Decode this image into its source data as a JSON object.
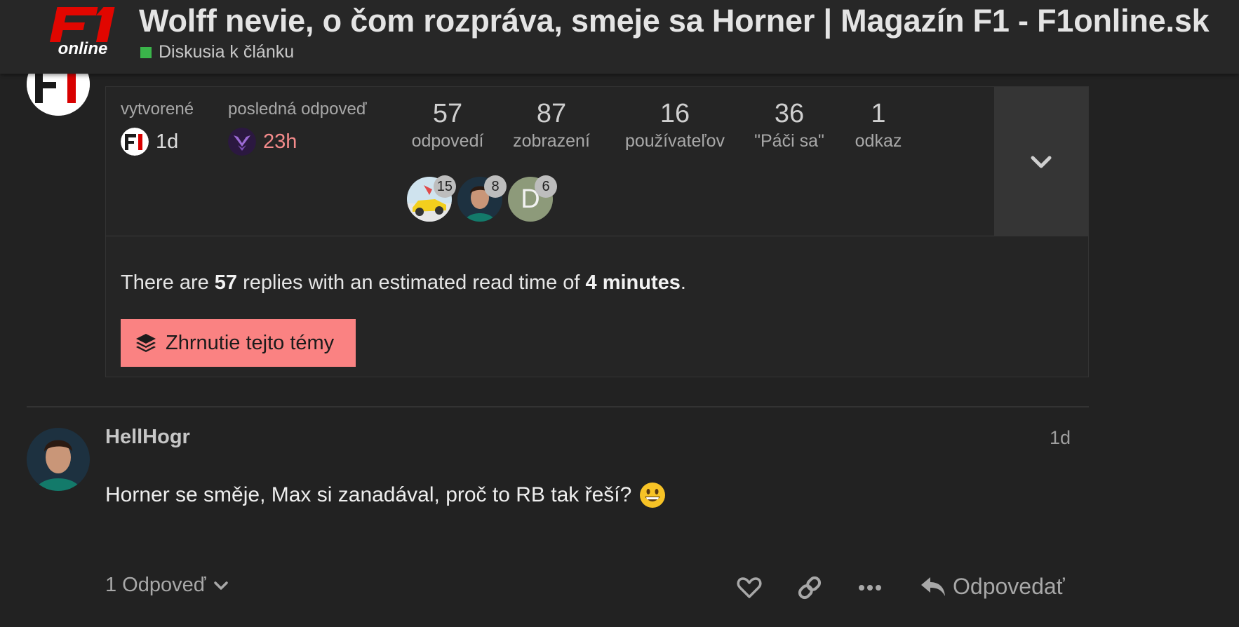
{
  "header": {
    "logo_text": "F1 online",
    "title": "Wolff nevie, o čom rozpráva, smeje sa Horner | Magazín F1 - F1online.sk",
    "category": "Diskusia k článku",
    "category_color": "#3ab54a"
  },
  "topic_map": {
    "created_label": "vytvorené",
    "created_time": "1d",
    "last_reply_label": "posledná odpoveď",
    "last_reply_time": "23h",
    "stats": [
      {
        "num": "57",
        "label": "odpovedí"
      },
      {
        "num": "87",
        "label": "zobrazení"
      },
      {
        "num": "16",
        "label": "používateľov"
      },
      {
        "num": "36",
        "label": "\"Páči sa\""
      },
      {
        "num": "1",
        "label": "odkaz"
      }
    ],
    "participants": [
      {
        "count": "15"
      },
      {
        "count": "8"
      },
      {
        "letter": "D",
        "count": "6"
      }
    ],
    "summary": {
      "prefix": "There are ",
      "replies": "57",
      "middle": " replies with an estimated read time of ",
      "time": "4 minutes",
      "suffix": "."
    },
    "summarize_button": "Zhrnutie tejto témy",
    "expand_icon": "chevron-down-icon"
  },
  "post": {
    "username": "HellHogr",
    "date": "1d",
    "body": "Horner se směje, Max si zanadával, proč to RB tak řeší?",
    "emoji": "grinning-face",
    "replies_label": "1 Odpoveď",
    "reply_button": "Odpovedať"
  },
  "colors": {
    "accent": "#fa8282",
    "background": "#222222",
    "recent_time": "#f48b8b"
  }
}
